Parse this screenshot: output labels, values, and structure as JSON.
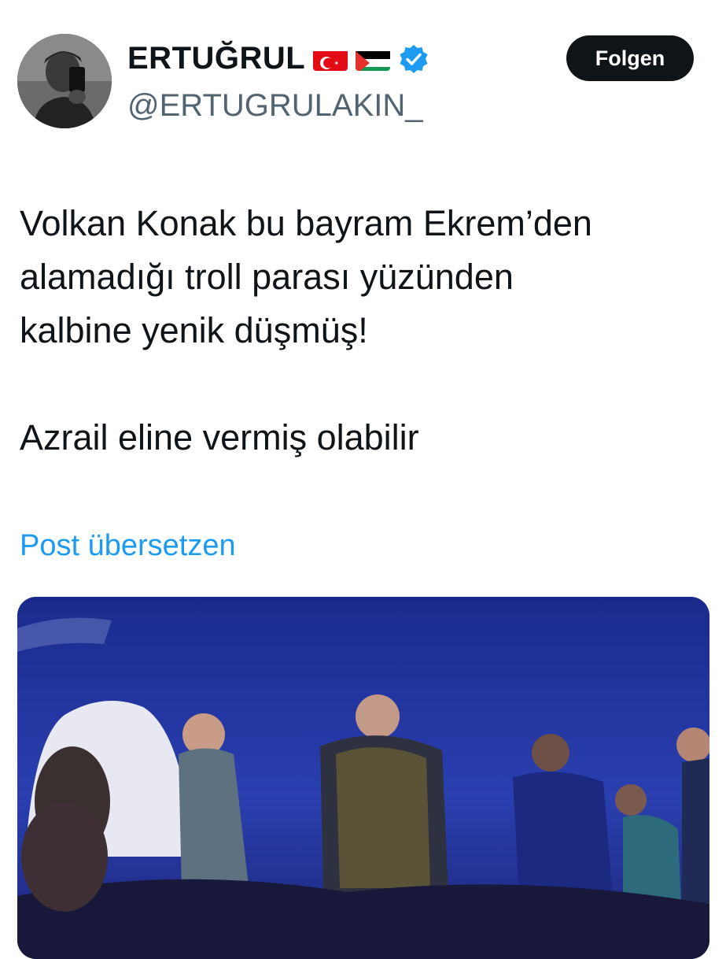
{
  "author": {
    "display_name": "ERTUĞRUL",
    "handle": "@ERTUGRULAKIN_",
    "flags": [
      "turkey-flag-icon",
      "palestine-flag-icon"
    ],
    "verified": true
  },
  "follow_button": {
    "label": "Folgen"
  },
  "tweet": {
    "line1": "Volkan Konak bu bayram Ekrem’den",
    "line2": "alamadığı troll parası yüzünden",
    "line3": "kalbine yenik düşmüş!",
    "line4": "Azrail eline vermiş olabilir"
  },
  "translate": {
    "label": "Post übersetzen"
  },
  "colors": {
    "text": "#0f1419",
    "secondary": "#536471",
    "link": "#1d9bf0",
    "verified": "#1d9bf0",
    "button_bg": "#0f1419"
  }
}
